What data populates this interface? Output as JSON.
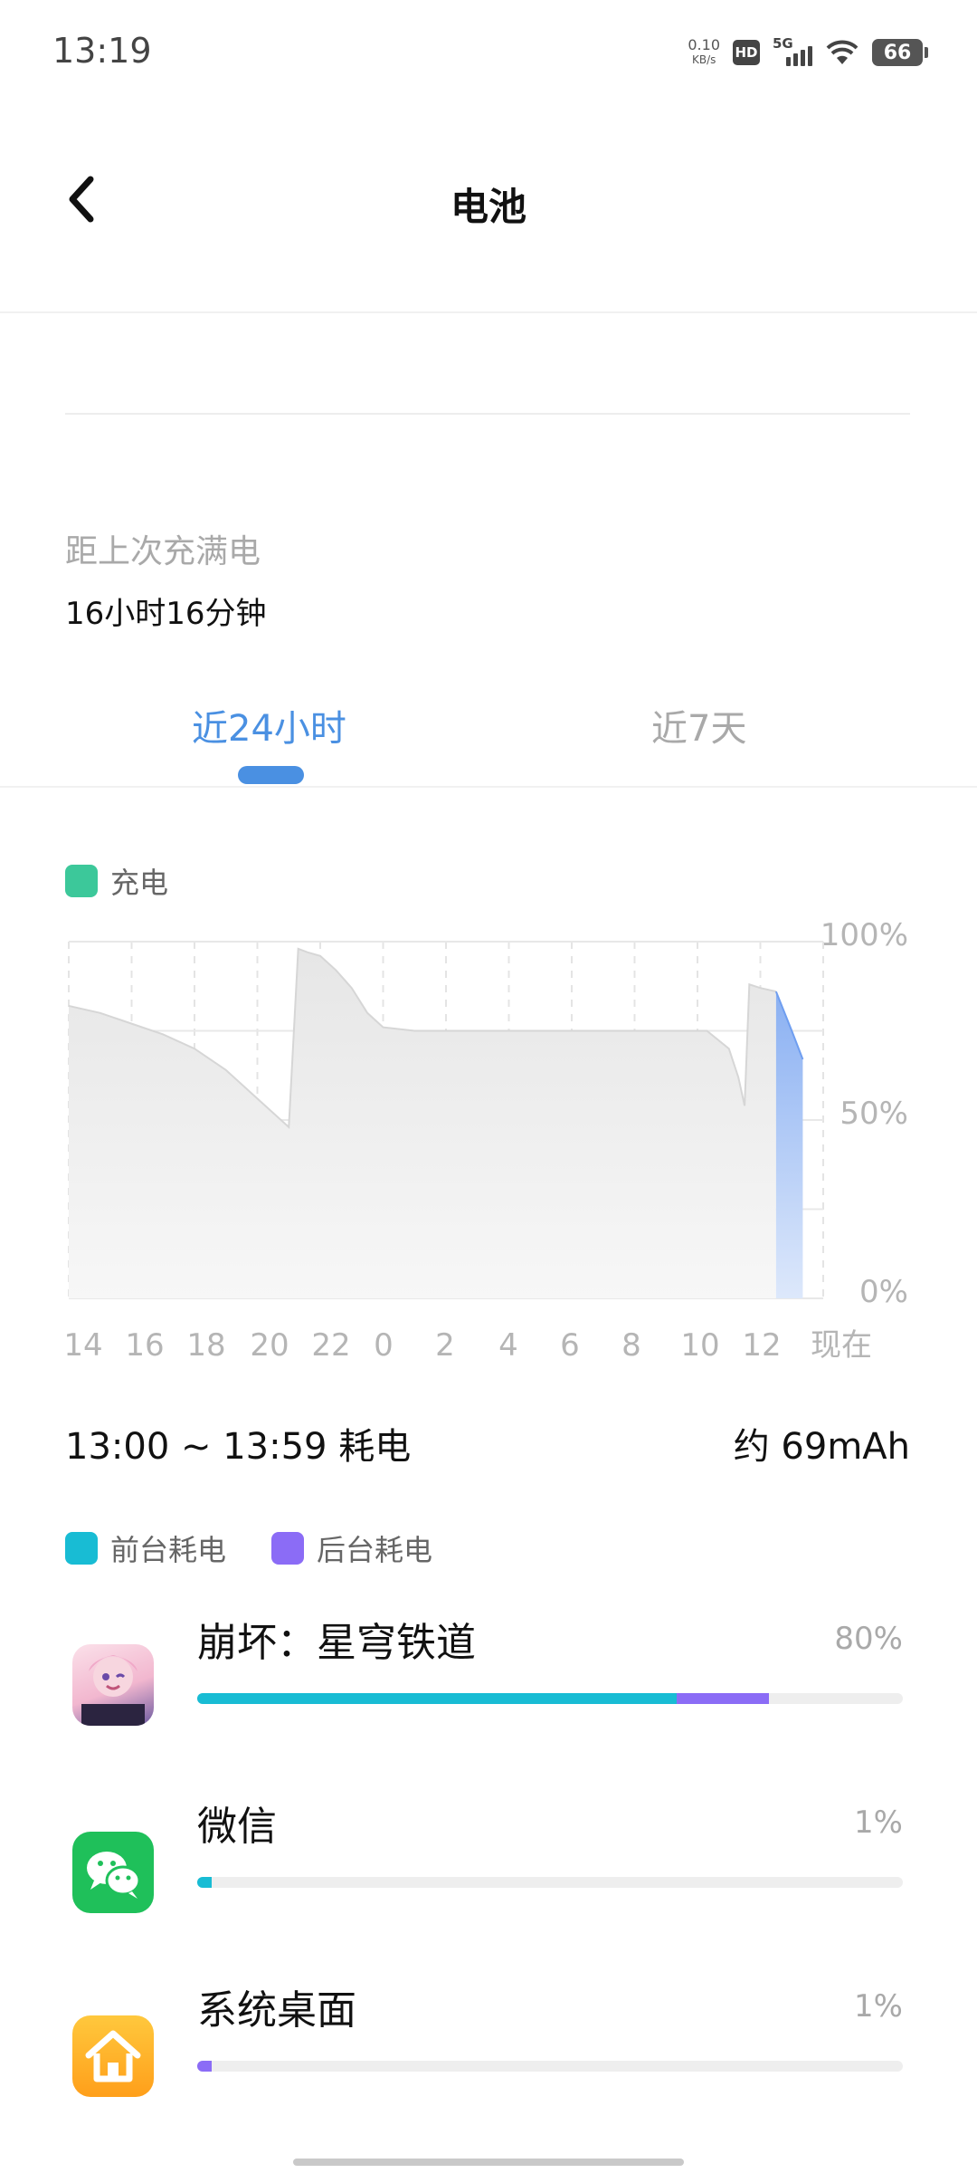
{
  "status_bar": {
    "time": "13:19",
    "net_speed_value": "0.10",
    "net_speed_unit": "KB/s",
    "hd_label": "HD",
    "network_label": "5G",
    "battery_level": "66"
  },
  "header": {
    "title": "电池",
    "back_icon": "chevron-left-icon"
  },
  "summary": {
    "since_full_label": "距上次充满电",
    "since_full_value": "16小时16分钟"
  },
  "tabs": [
    {
      "label": "近24小时",
      "active": true
    },
    {
      "label": "近7天",
      "active": false
    }
  ],
  "chart_legend": {
    "charge_label": "充电",
    "charge_color": "#3cc89a"
  },
  "chart_data": {
    "type": "area",
    "x_ticks": [
      "14",
      "16",
      "18",
      "20",
      "22",
      "0",
      "2",
      "4",
      "6",
      "8",
      "10",
      "12",
      "现在"
    ],
    "y_ticks": [
      "100%",
      "50%",
      "0%"
    ],
    "ylim": [
      0,
      100
    ],
    "series": [
      {
        "values": [
          [
            0,
            82
          ],
          [
            1,
            80
          ],
          [
            2,
            77
          ],
          [
            3,
            74
          ],
          [
            4,
            70
          ],
          [
            5,
            64
          ],
          [
            6,
            56
          ],
          [
            7,
            48
          ],
          [
            7.3,
            98
          ],
          [
            7.6,
            97
          ],
          [
            8,
            96
          ],
          [
            8.5,
            92
          ],
          [
            9,
            87
          ],
          [
            9.5,
            80
          ],
          [
            10,
            76
          ],
          [
            11,
            75
          ],
          [
            13,
            75
          ],
          [
            15,
            75
          ],
          [
            17,
            75
          ],
          [
            20.3,
            75
          ],
          [
            21,
            70
          ],
          [
            21.3,
            62
          ],
          [
            21.5,
            54
          ],
          [
            21.65,
            88
          ],
          [
            22,
            87
          ],
          [
            22.5,
            86
          ]
        ]
      },
      {
        "values": [
          [
            22.5,
            86
          ],
          [
            23,
            75
          ],
          [
            23.35,
            67
          ]
        ],
        "highlight": true,
        "color": "#8ab0f2"
      }
    ],
    "grid": true
  },
  "consumption": {
    "range_label": "13:00 ~ 13:59 耗电",
    "total_label": "约 69mAh",
    "legend": [
      {
        "label": "前台耗电",
        "color": "#18bcd4"
      },
      {
        "label": "后台耗电",
        "color": "#8b6cf6"
      }
    ]
  },
  "apps": [
    {
      "name": "崩坏：星穹铁道",
      "percent_label": "80%",
      "foreground": 0.68,
      "background": 0.13,
      "icon": "honkai-star-rail-icon"
    },
    {
      "name": "微信",
      "percent_label": "1%",
      "foreground": 0.02,
      "background": 0.0,
      "icon": "wechat-icon"
    },
    {
      "name": "系统桌面",
      "percent_label": "1%",
      "foreground": 0.0,
      "background": 0.02,
      "icon": "home-launcher-icon"
    }
  ]
}
